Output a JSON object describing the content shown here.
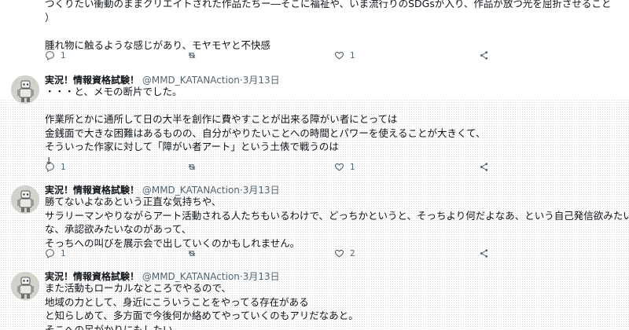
{
  "top_tweet": {
    "lines": [
      "つくりたい衝動のままクリエイトされた作品たちー―そこに福祉や、いま流行りのSDGsが入り、作品が放つ光を屈折させること",
      "）",
      "",
      "腫れ物に触るような感じがあり、モヤモヤと不快感"
    ],
    "reply_count": "1",
    "retweet_count": "",
    "like_count": "1"
  },
  "tweets": [
    {
      "author_name": "実況！情報資格試験！",
      "handle": "@MMD_KATANAction",
      "separator": "·",
      "date": "3月13日",
      "lines": [
        "・・・と、メモの断片でした。",
        "",
        "作業所とかに通所して日の大半を創作に費やすことが出来る障がい者にとっては",
        "金銭面で大きな困難はあるものの、自分がやりたいことへの時間とパワーを使えることが大きくて、",
        "そういった作家に対して「障がい者アート」という土俵で戦うのは",
        "↓"
      ],
      "reply_count": "1",
      "retweet_count": "",
      "like_count": "1"
    },
    {
      "author_name": "実況！情報資格試験！",
      "handle": "@MMD_KATANAction",
      "separator": "·",
      "date": "3月13日",
      "lines": [
        "勝てないよなあという正直な気持ちや、",
        "サラリーマンやりながらアート活動される人たちもいるわけで、どっちかというと、そっちより何だよなあ、という自己発信欲みたい",
        "な、承認欲みたいなのがあって、",
        "そっちへの叫びを展示会で出していくのかもしれません。"
      ],
      "reply_count": "1",
      "retweet_count": "",
      "like_count": "2"
    },
    {
      "author_name": "実況！情報資格試験！",
      "handle": "@MMD_KATANAction",
      "separator": "·",
      "date": "3月13日",
      "lines": [
        "また活動もローカルなところでやるので、",
        "地域の力として、身近にこういうことをやってる存在がある",
        "と知らしめて、多方面で今後何か絡めてやっていくのもアリだなあと。",
        "そこへの足がかりにもしたい"
      ]
    }
  ],
  "icons": {
    "reply": "reply-icon",
    "retweet": "retweet-icon",
    "like": "like-icon",
    "share": "share-icon",
    "avatar": "robot-avatar"
  }
}
